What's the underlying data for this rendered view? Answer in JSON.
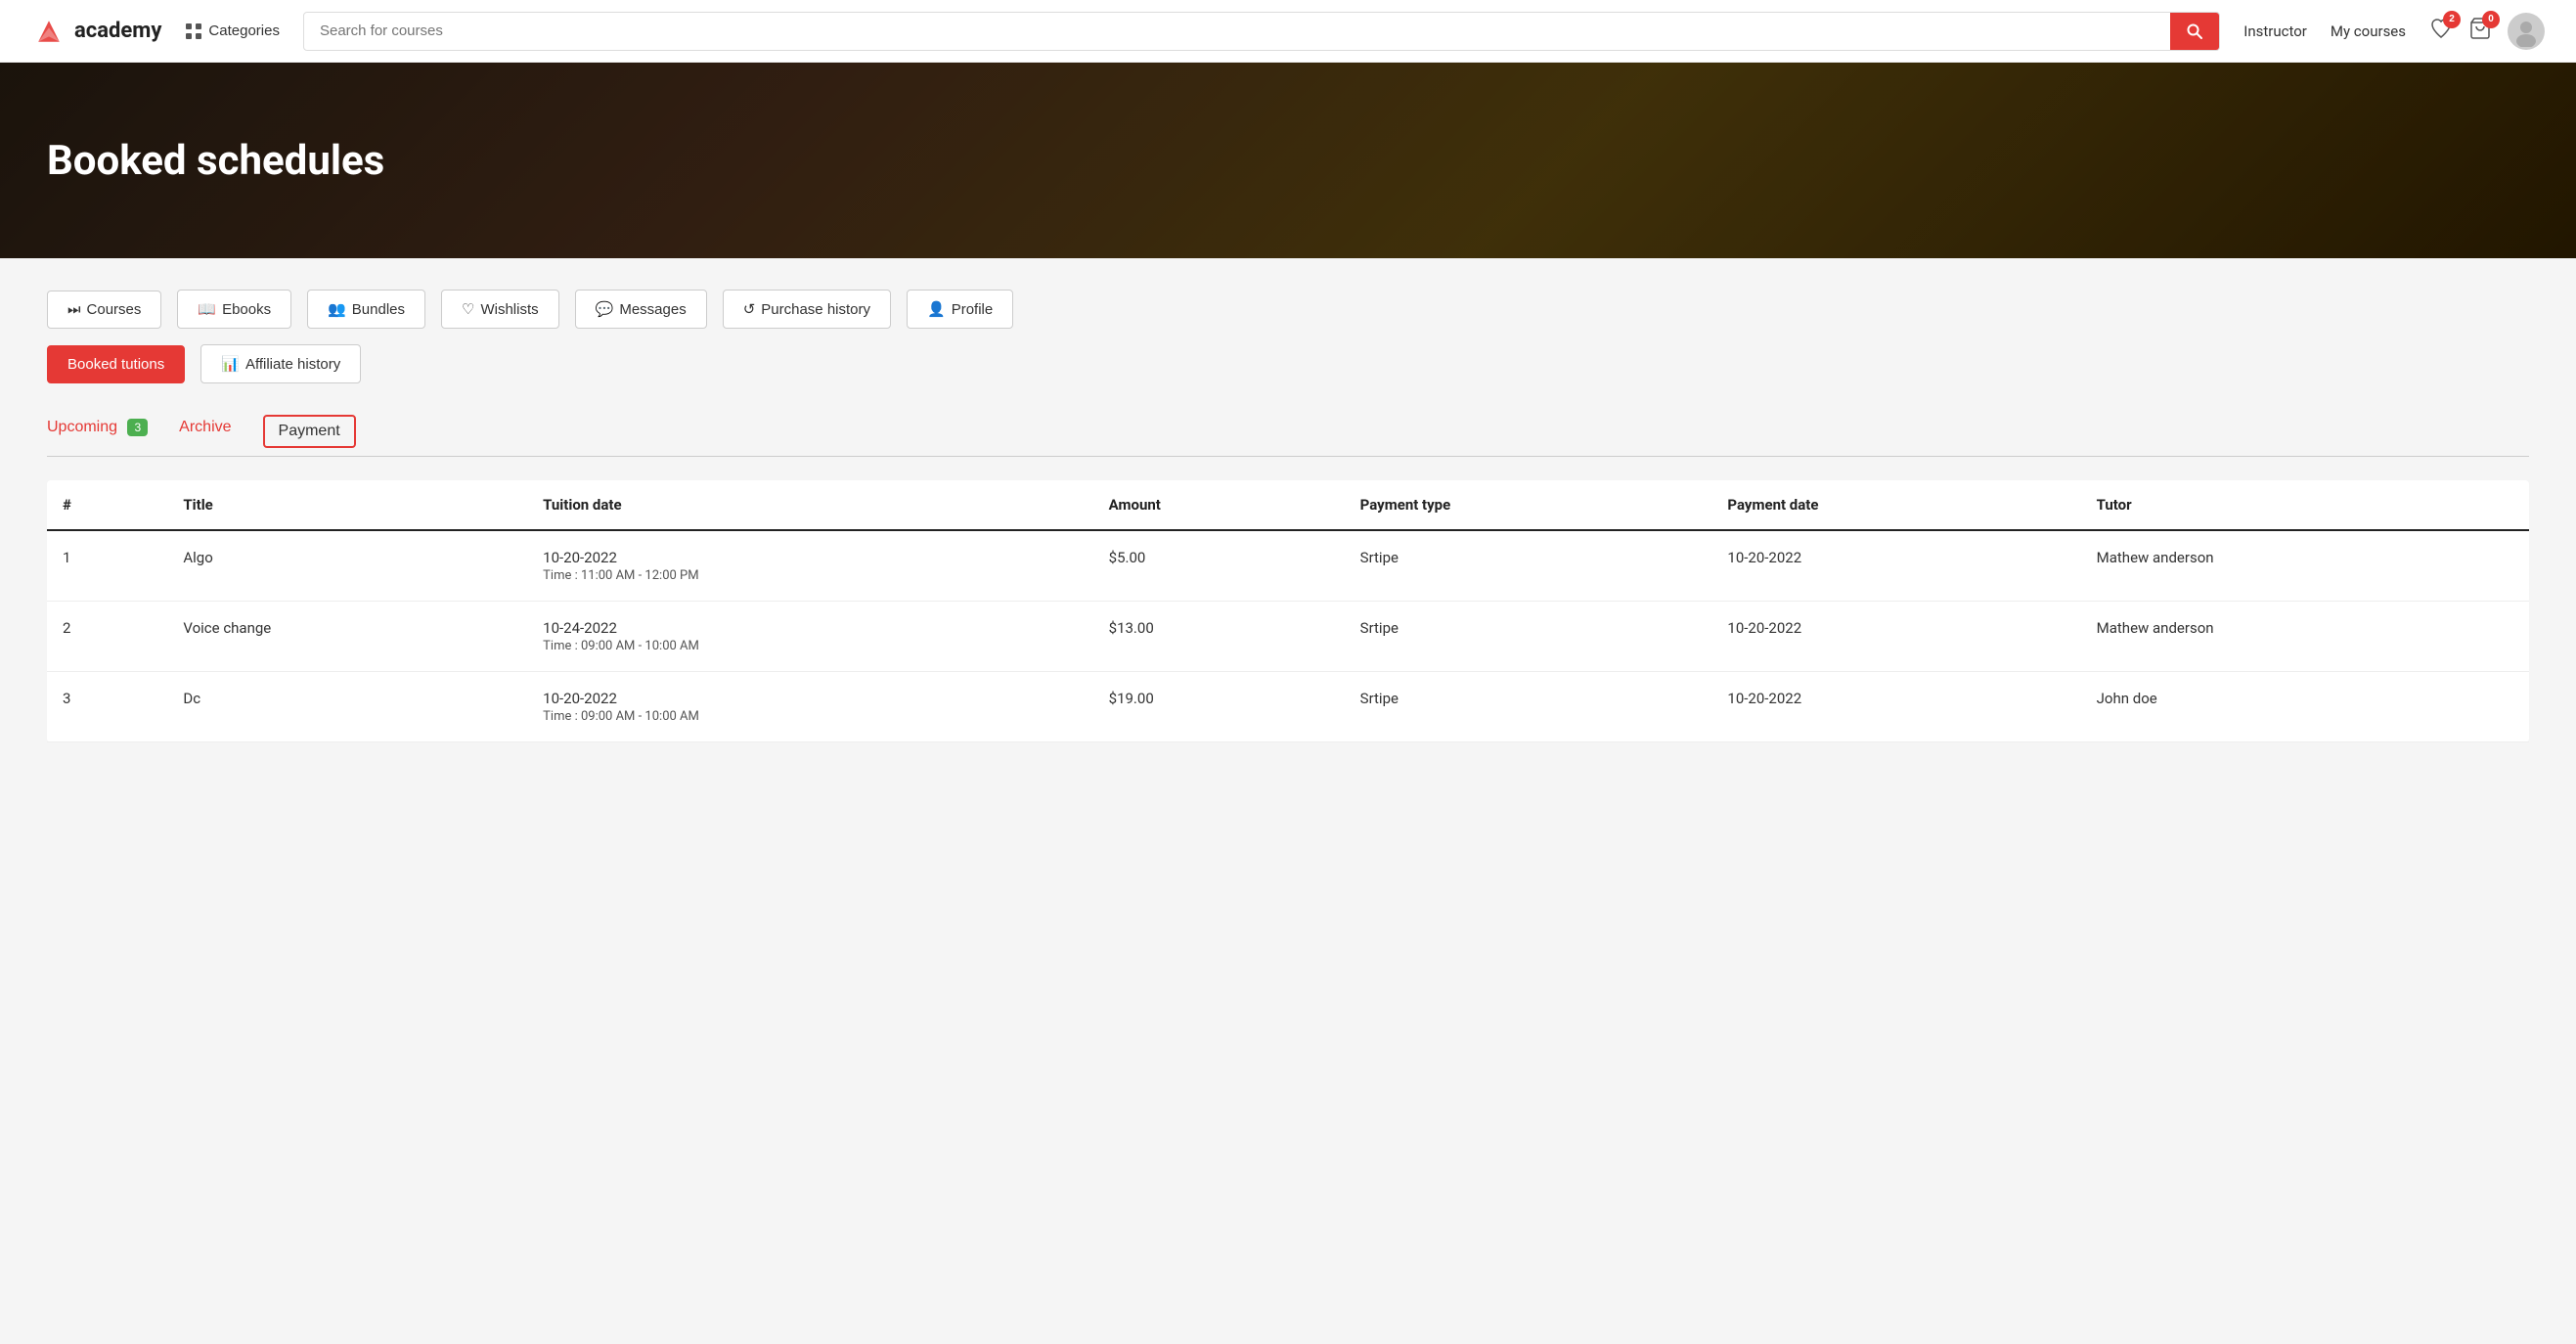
{
  "navbar": {
    "logo_text": "academy",
    "categories_label": "Categories",
    "search_placeholder": "Search for courses",
    "instructor_label": "Instructor",
    "my_courses_label": "My courses",
    "wishlist_count": "2",
    "cart_count": "0"
  },
  "hero": {
    "title": "Booked schedules"
  },
  "nav_tabs": [
    {
      "id": "courses",
      "icon": "⏭",
      "label": "Courses",
      "active": false
    },
    {
      "id": "ebooks",
      "icon": "📖",
      "label": "Ebooks",
      "active": false
    },
    {
      "id": "bundles",
      "icon": "👥",
      "label": "Bundles",
      "active": false
    },
    {
      "id": "wishlists",
      "icon": "♡",
      "label": "Wishlists",
      "active": false
    },
    {
      "id": "messages",
      "icon": "💬",
      "label": "Messages",
      "active": false
    },
    {
      "id": "purchase-history",
      "icon": "↺",
      "label": "Purchase history",
      "active": false
    },
    {
      "id": "profile",
      "icon": "👤",
      "label": "Profile",
      "active": false
    }
  ],
  "nav_tabs2": [
    {
      "id": "booked-tutions",
      "label": "Booked tutions",
      "active": true
    },
    {
      "id": "affiliate-history",
      "icon": "📊",
      "label": "Affiliate history",
      "active": false
    }
  ],
  "sub_tabs": [
    {
      "id": "upcoming",
      "label": "Upcoming",
      "badge": "3",
      "style": "red"
    },
    {
      "id": "archive",
      "label": "Archive",
      "style": "red"
    },
    {
      "id": "payment",
      "label": "Payment",
      "style": "outlined-active"
    }
  ],
  "table": {
    "columns": [
      "#",
      "Title",
      "Tuition date",
      "Amount",
      "Payment type",
      "Payment date",
      "Tutor"
    ],
    "rows": [
      {
        "num": "1",
        "title": "Algo",
        "tuition_date": "10-20-2022",
        "tuition_time": "Time : 11:00 AM - 12:00 PM",
        "amount": "$5.00",
        "payment_type": "Srtipe",
        "payment_date": "10-20-2022",
        "tutor": "Mathew anderson"
      },
      {
        "num": "2",
        "title": "Voice change",
        "tuition_date": "10-24-2022",
        "tuition_time": "Time : 09:00 AM - 10:00 AM",
        "amount": "$13.00",
        "payment_type": "Srtipe",
        "payment_date": "10-20-2022",
        "tutor": "Mathew anderson"
      },
      {
        "num": "3",
        "title": "Dc",
        "tuition_date": "10-20-2022",
        "tuition_time": "Time : 09:00 AM - 10:00 AM",
        "amount": "$19.00",
        "payment_type": "Srtipe",
        "payment_date": "10-20-2022",
        "tutor": "John doe"
      }
    ]
  }
}
